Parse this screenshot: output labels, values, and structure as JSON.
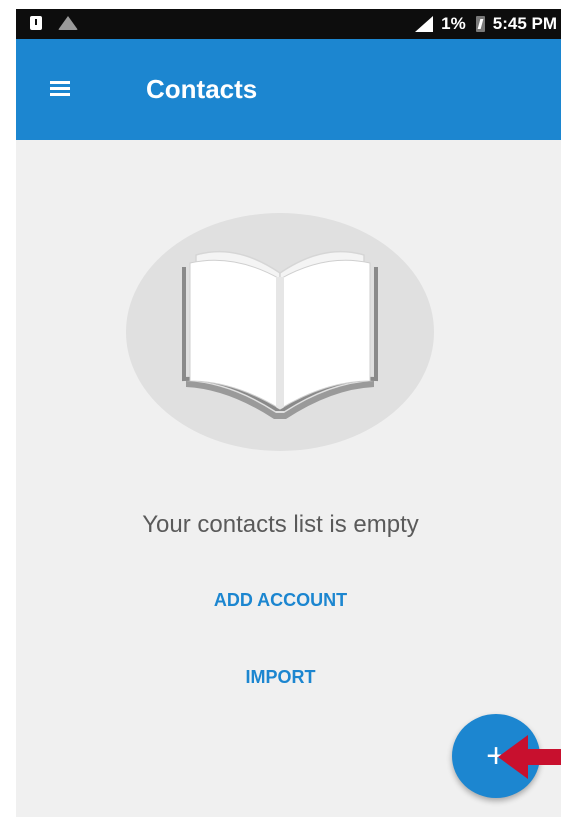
{
  "status_bar": {
    "battery_percent": "1%",
    "time": "5:45 PM",
    "icons": [
      "notification-icon",
      "wifi-icon",
      "signal-icon",
      "battery-charging-icon"
    ]
  },
  "app_bar": {
    "title": "Contacts",
    "menu_icon": "hamburger-menu-icon"
  },
  "empty_state": {
    "illustration": "open-book-icon",
    "message": "Your contacts list is empty",
    "add_account_label": "ADD ACCOUNT",
    "import_label": "IMPORT"
  },
  "fab": {
    "label": "+",
    "icon": "plus-icon"
  },
  "colors": {
    "accent": "#1c86d0",
    "status_bar": "#0d0d0d",
    "background": "#f0f0f0",
    "annotation_arrow": "#c8102e"
  }
}
